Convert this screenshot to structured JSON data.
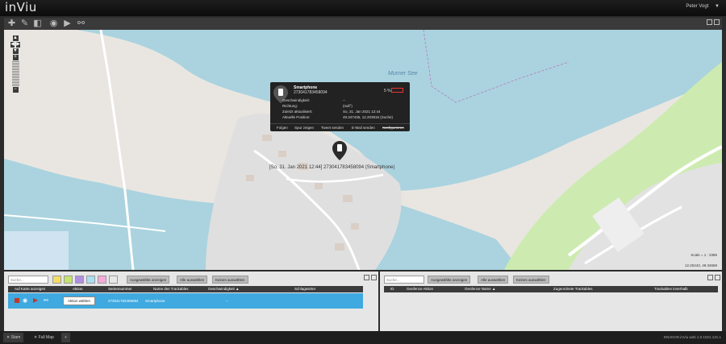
{
  "app": {
    "logo": "inViu",
    "user": "Peter Vogt"
  },
  "map": {
    "lake_label": "Murner See",
    "marker_label": "[So, 31. Jan 2021 12:44] 273041783458094 (Smartphone)",
    "scale_text": "Scale = 1 : 3385",
    "coords_text": "12.20443, 49.34659"
  },
  "popup": {
    "title": "Smartphone",
    "serial": "273041783458094",
    "battery_pct": "5 %",
    "rows": [
      {
        "label": "Geschwindigkeit:",
        "value": "--"
      },
      {
        "label": "Richtung:",
        "value": "(null°)"
      },
      {
        "label": "Zuletzt aktualisiert:",
        "value": "So, 31. Jan 2021 12:44"
      },
      {
        "label": "Aktuelle Position:",
        "value": "49.347435, 12.203916 (Suche)"
      }
    ],
    "actions": [
      "Folgen",
      "Spur zeigen",
      "Tweet senden",
      "E-Mail senden",
      "Konfigurieren"
    ]
  },
  "left_panel": {
    "search_placeholder": "Suche...",
    "buttons": [
      "Ausgewählte anzeigen",
      "Alle auswählen",
      "Keines auswählen"
    ],
    "columns": [
      "Auf Karte anzeigen",
      "Aktion",
      "Seriennummer",
      "Name des Trackables",
      "Geschwindigkeit ▲",
      "Schlagwörter"
    ],
    "row": {
      "select_label": "Aktion wählen",
      "serial": "273041783458094",
      "name": "Smartphone",
      "speed": "--"
    }
  },
  "right_panel": {
    "search_placeholder": "Suche...",
    "buttons": [
      "Ausgewählte anzeigen",
      "Alle auswählen",
      "Keines auswählen"
    ],
    "columns": [
      "ID",
      "Geofence Aktion",
      "Geofence Name ▲",
      "Zugeordnete Trackables",
      "Trackables innerhalb"
    ]
  },
  "bottom": {
    "tabs": [
      "Stam",
      "Full Map",
      "+"
    ],
    "version": "ENAKON inViu web 1.0.1021.131.1"
  }
}
